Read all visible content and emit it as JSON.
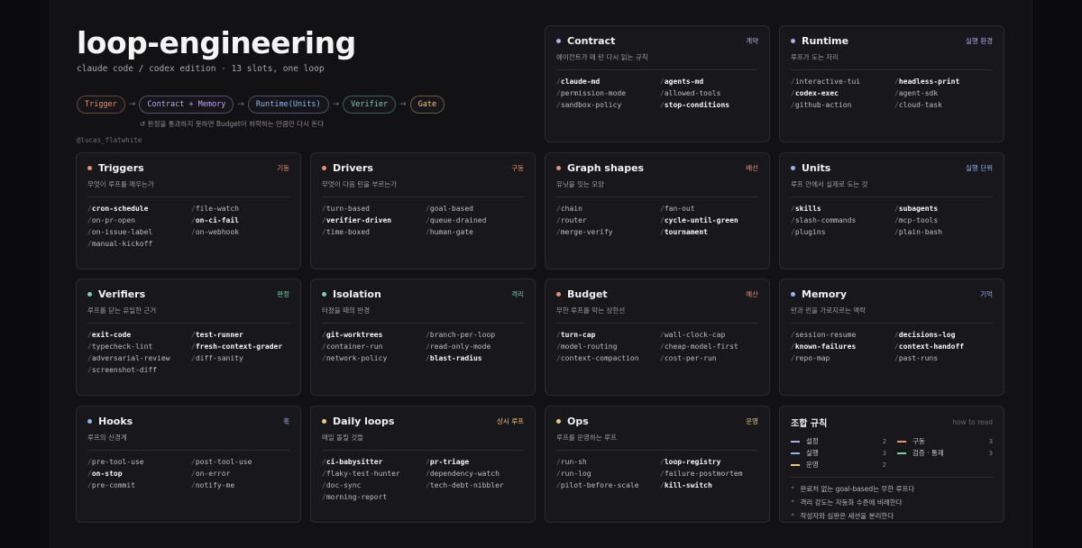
{
  "hero": {
    "title": "loop-engineering",
    "subtitle": "claude code / codex edition  ·  13 slots, one loop",
    "flow": [
      {
        "label": "Trigger",
        "color": "#e8916a"
      },
      {
        "label": "Contract + Memory",
        "color": "#b9a5f0"
      },
      {
        "label": "Runtime(Units)",
        "color": "#8eb5f0"
      },
      {
        "label": "Verifier",
        "color": "#6fd6a2"
      },
      {
        "label": "Gate",
        "color": "#f0c877"
      }
    ],
    "arrow": "→",
    "note": "↺ 판정을 통과하지 못하면 Budget이 허락하는 만큼만 다시 돈다",
    "credit": "@lucas_flatwhite"
  },
  "cards": [
    {
      "id": "contract",
      "title": "Contract",
      "tag": "계약",
      "color": "#b9a5f0",
      "sub": "에이전트가 매 턴 다시 읽는 규칙",
      "items": [
        {
          "t": "claude-md",
          "hi": true
        },
        {
          "t": "agents-md",
          "hi": true
        },
        {
          "t": "permission-mode",
          "hi": false
        },
        {
          "t": "allowed-tools",
          "hi": false
        },
        {
          "t": "sandbox-policy",
          "hi": false
        },
        {
          "t": "stop-conditions",
          "hi": true
        }
      ]
    },
    {
      "id": "runtime",
      "title": "Runtime",
      "tag": "실행 환경",
      "color": "#b9a5f0",
      "sub": "루프가 도는 자리",
      "items": [
        {
          "t": "interactive-tui",
          "hi": false
        },
        {
          "t": "headless-print",
          "hi": true
        },
        {
          "t": "codex-exec",
          "hi": true
        },
        {
          "t": "agent-sdk",
          "hi": false
        },
        {
          "t": "github-action",
          "hi": false
        },
        {
          "t": "cloud-task",
          "hi": false
        }
      ]
    },
    {
      "id": "triggers",
      "title": "Triggers",
      "tag": "기동",
      "color": "#e8916a",
      "sub": "무엇이 루프를 깨우는가",
      "items": [
        {
          "t": "cron-schedule",
          "hi": true
        },
        {
          "t": "file-watch",
          "hi": false
        },
        {
          "t": "on-pr-open",
          "hi": false
        },
        {
          "t": "on-ci-fail",
          "hi": true
        },
        {
          "t": "on-issue-label",
          "hi": false
        },
        {
          "t": "on-webhook",
          "hi": false
        },
        {
          "t": "manual-kickoff",
          "hi": false
        }
      ]
    },
    {
      "id": "drivers",
      "title": "Drivers",
      "tag": "구동",
      "color": "#e8916a",
      "sub": "무엇이 다음 턴을 부르는가",
      "items": [
        {
          "t": "turn-based",
          "hi": false
        },
        {
          "t": "goal-based",
          "hi": false
        },
        {
          "t": "verifier-driven",
          "hi": true
        },
        {
          "t": "queue-drained",
          "hi": false
        },
        {
          "t": "time-boxed",
          "hi": false
        },
        {
          "t": "human-gate",
          "hi": false
        }
      ]
    },
    {
      "id": "graph",
      "title": "Graph shapes",
      "tag": "배선",
      "color": "#e8916a",
      "sub": "유닛을 잇는 모양",
      "items": [
        {
          "t": "chain",
          "hi": false
        },
        {
          "t": "fan-out",
          "hi": false
        },
        {
          "t": "router",
          "hi": false
        },
        {
          "t": "cycle-until-green",
          "hi": true
        },
        {
          "t": "merge-verify",
          "hi": false
        },
        {
          "t": "tournament",
          "hi": true
        }
      ]
    },
    {
      "id": "units",
      "title": "Units",
      "tag": "실행 단위",
      "color": "#8eb5f0",
      "sub": "루프 안에서 실제로 도는 것",
      "items": [
        {
          "t": "skills",
          "hi": true
        },
        {
          "t": "subagents",
          "hi": true
        },
        {
          "t": "slash-commands",
          "hi": false
        },
        {
          "t": "mcp-tools",
          "hi": false
        },
        {
          "t": "plugins",
          "hi": false
        },
        {
          "t": "plain-bash",
          "hi": false
        }
      ]
    },
    {
      "id": "verifiers",
      "title": "Verifiers",
      "tag": "판정",
      "color": "#6fd6a2",
      "sub": "루프를 닫는 유일한 근거",
      "items": [
        {
          "t": "exit-code",
          "hi": true
        },
        {
          "t": "test-runner",
          "hi": true
        },
        {
          "t": "typecheck-lint",
          "hi": false
        },
        {
          "t": "fresh-context-grader",
          "hi": true
        },
        {
          "t": "adversarial-review",
          "hi": false
        },
        {
          "t": "diff-sanity",
          "hi": false
        },
        {
          "t": "screenshot-diff",
          "hi": false
        }
      ]
    },
    {
      "id": "isolation",
      "title": "Isolation",
      "tag": "격리",
      "color": "#6fd6a2",
      "sub": "터졌을 때의 반경",
      "items": [
        {
          "t": "git-worktrees",
          "hi": true
        },
        {
          "t": "branch-per-loop",
          "hi": false
        },
        {
          "t": "container-run",
          "hi": false
        },
        {
          "t": "read-only-mode",
          "hi": false
        },
        {
          "t": "network-policy",
          "hi": false
        },
        {
          "t": "blast-radius",
          "hi": true
        }
      ]
    },
    {
      "id": "budget",
      "title": "Budget",
      "tag": "예산",
      "color": "#e8916a",
      "sub": "무한 루프를 막는 상한선",
      "items": [
        {
          "t": "turn-cap",
          "hi": true
        },
        {
          "t": "wall-clock-cap",
          "hi": false
        },
        {
          "t": "model-routing",
          "hi": false
        },
        {
          "t": "cheap-model-first",
          "hi": false
        },
        {
          "t": "context-compaction",
          "hi": false
        },
        {
          "t": "cost-per-run",
          "hi": false
        }
      ]
    },
    {
      "id": "memory",
      "title": "Memory",
      "tag": "기억",
      "color": "#8eb5f0",
      "sub": "턴과 런을 가로지르는 맥락",
      "items": [
        {
          "t": "session-resume",
          "hi": false
        },
        {
          "t": "decisions-log",
          "hi": true
        },
        {
          "t": "known-failures",
          "hi": true
        },
        {
          "t": "context-handoff",
          "hi": true
        },
        {
          "t": "repo-map",
          "hi": false
        },
        {
          "t": "past-runs",
          "hi": false
        }
      ]
    },
    {
      "id": "hooks",
      "title": "Hooks",
      "tag": "훅",
      "color": "#8eb5f0",
      "sub": "루프의 신경계",
      "items": [
        {
          "t": "pre-tool-use",
          "hi": false
        },
        {
          "t": "post-tool-use",
          "hi": false
        },
        {
          "t": "on-stop",
          "hi": true
        },
        {
          "t": "on-error",
          "hi": false
        },
        {
          "t": "pre-commit",
          "hi": false
        },
        {
          "t": "notify-me",
          "hi": false
        }
      ]
    },
    {
      "id": "daily",
      "title": "Daily loops",
      "tag": "상시 루프",
      "color": "#f0c877",
      "sub": "매일 돌릴 것들",
      "items": [
        {
          "t": "ci-babysitter",
          "hi": true
        },
        {
          "t": "pr-triage",
          "hi": true
        },
        {
          "t": "flaky-test-hunter",
          "hi": false
        },
        {
          "t": "dependency-watch",
          "hi": false
        },
        {
          "t": "doc-sync",
          "hi": false
        },
        {
          "t": "tech-debt-nibbler",
          "hi": false
        },
        {
          "t": "morning-report",
          "hi": false
        }
      ]
    },
    {
      "id": "ops",
      "title": "Ops",
      "tag": "운영",
      "color": "#f0c877",
      "sub": "루프를 운영하는 루프",
      "items": [
        {
          "t": "run-sh",
          "hi": false
        },
        {
          "t": "loop-registry",
          "hi": true
        },
        {
          "t": "run-log",
          "hi": false
        },
        {
          "t": "failure-postmortem",
          "hi": false
        },
        {
          "t": "pilot-before-scale",
          "hi": false
        },
        {
          "t": "kill-switch",
          "hi": true
        }
      ]
    }
  ],
  "rules": {
    "title": "조합 규칙",
    "hint": "how to read",
    "legend": [
      {
        "name": "설정",
        "count": "2",
        "color": "#b9a5f0"
      },
      {
        "name": "구동",
        "count": "3",
        "color": "#e8916a"
      },
      {
        "name": "실행",
        "count": "3",
        "color": "#8eb5f0"
      },
      {
        "name": "검증 · 통제",
        "count": "3",
        "color": "#6fd6a2"
      },
      {
        "name": "운영",
        "count": "2",
        "color": "#f0c877"
      }
    ],
    "bullets": [
      "완료처 없는 goal-based는 무한 루프다",
      "격리 강도는 자동화 수준에 비례한다",
      "작성자와 심판은 세션을 분리한다"
    ],
    "bullet_mark": "•"
  }
}
